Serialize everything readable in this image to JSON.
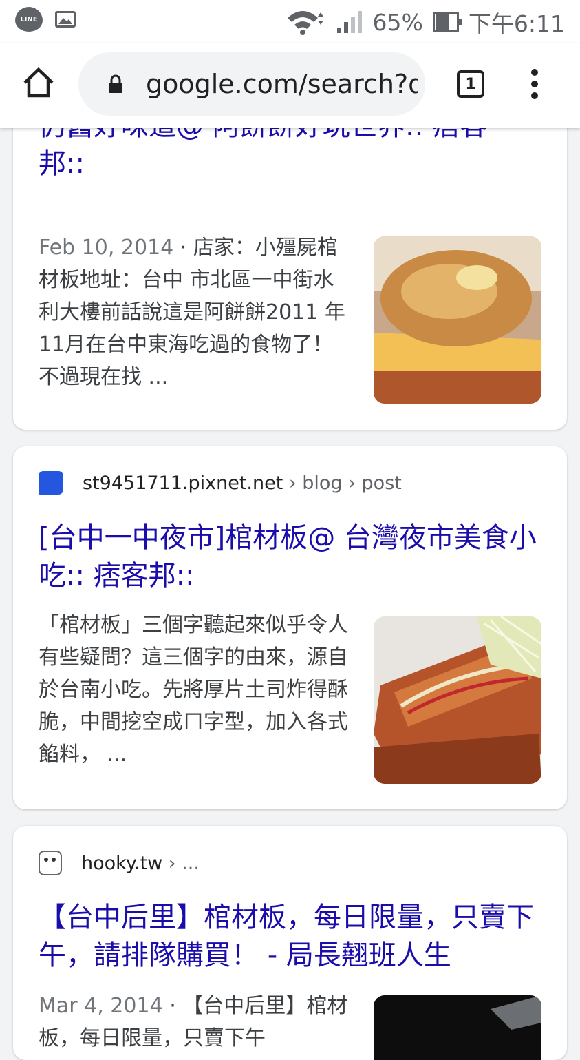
{
  "status_bar": {
    "line_app": "LINE",
    "battery": "65%",
    "time": "下午6:11"
  },
  "toolbar": {
    "url": "google.com/search?q=",
    "tab_count": "1"
  },
  "results": [
    {
      "title_partial": "【食采】小殭屍棺材板－十五年過去了仍舊好味道@ 阿餅餅好玩世界:: 痞客邦::",
      "title_line1": "仍舊好味道@ 阿餅餅好玩世界:: 痞客",
      "title_line2": "邦::",
      "date": "Feb 10, 2014",
      "snippet": " · 店家：小殭屍棺材板地址：台中 市北區一中街水利大樓前話說這是阿餅餅2011 年11月在台中東海吃過的食物了！ 不過現在找 ...",
      "thumb_icon": "fried-toast-image"
    },
    {
      "site": "st9451711.pixnet.net",
      "crumbs": " › blog › post",
      "title": "[台中一中夜市]棺材板@ 台灣夜市美食小吃:: 痞客邦::",
      "snippet": "「棺材板」三個字聽起來似乎令人有些疑問？這三個字的由來，源自於台南小吃。先將厚片土司炸得酥脆，中間挖空成ㄇ字型，加入各式餡料， ...",
      "thumb_icon": "coffin-bread-image"
    },
    {
      "site": "hooky.tw",
      "crumbs": " › ...",
      "title": "【台中后里】棺材板，每日限量，只賣下午，請排隊購買！ - 局長翹班人生",
      "date": "Mar 4, 2014",
      "snippet": " · 【台中后里】棺材板，每日限量，只賣下午",
      "thumb_icon": "dark-photo-image"
    }
  ],
  "colors": {
    "link": "#1a0dab",
    "background": "#f1f3f4",
    "pixnet_favicon": "#2456e0"
  }
}
